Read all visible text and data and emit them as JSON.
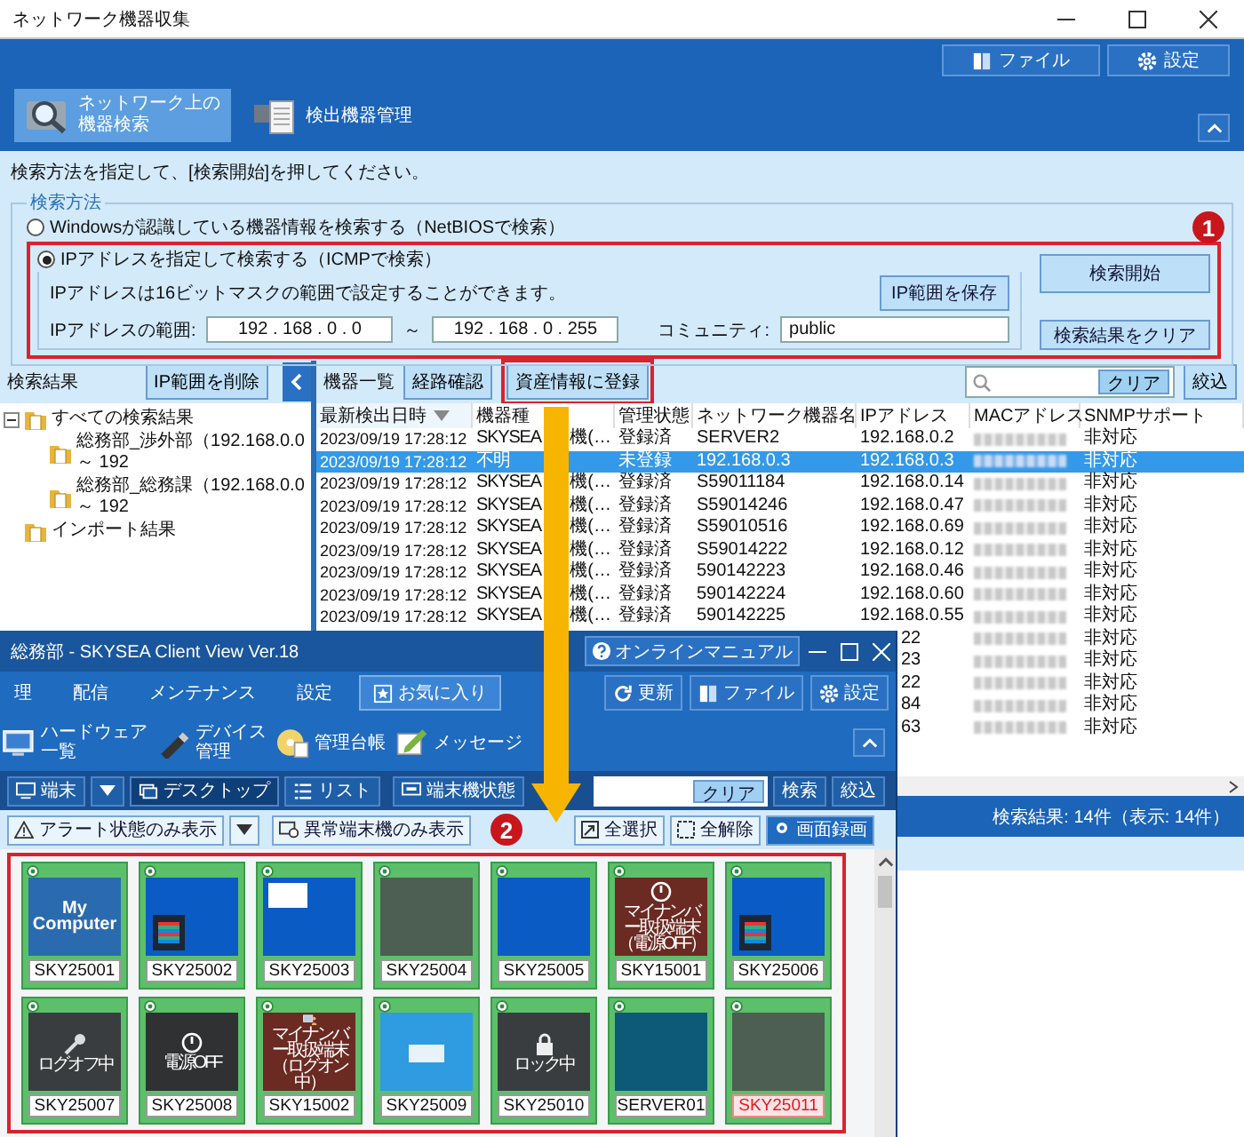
{
  "window": {
    "title": "ネットワーク機器収集",
    "menu_buttons": [
      {
        "kind": "file",
        "label": "ファイル"
      },
      {
        "kind": "gear",
        "label": "設定"
      }
    ]
  },
  "tabs": [
    {
      "kind": "search",
      "lines": [
        "ネットワーク上の",
        "機器検索"
      ],
      "selected": true
    },
    {
      "kind": "device",
      "lines": [
        "検出機器管理"
      ],
      "selected": false
    }
  ],
  "instruction": "検索方法を指定して、[検索開始]を押してください。",
  "search_method": {
    "legend": "検索方法",
    "options": [
      {
        "label": "Windowsが認識している機器情報を検索する（NetBIOSで検索）",
        "selected": false
      },
      {
        "label": "IPアドレスを指定して検索する（ICMPで検索）",
        "selected": true
      }
    ],
    "note": "IPアドレスは16ビットマスクの範囲で設定することができます。",
    "save_button": "IP範囲を保存",
    "range_label": "IPアドレスの範囲:",
    "range_from": "192 . 168 . 0 . 0",
    "range_separator": "～",
    "range_to": "192 . 168 . 0 . 255",
    "community_label": "コミュニティ:",
    "community": "public",
    "start_button": "検索開始",
    "clear_button": "検索結果をクリア"
  },
  "step_badges": [
    "1",
    "2"
  ],
  "results": {
    "title": "検索結果",
    "delete_button": "IP範囲を削除",
    "tree": [
      {
        "label": "すべての検索結果",
        "expanded": true,
        "children": [
          {
            "label": "総務部_渉外部（192.168.0.0 ～ 192"
          },
          {
            "label": "総務部_総務課（192.168.0.0 ～ 192"
          }
        ]
      },
      {
        "label": "インポート結果"
      }
    ]
  },
  "device_list": {
    "title": "機器一覧",
    "buttons": [
      {
        "label": "経路確認",
        "highlighted": false
      },
      {
        "label": "資産情報に登録",
        "highlighted": true
      }
    ],
    "clear_button": "クリア",
    "filter_button": "絞込",
    "columns": [
      {
        "label": "最新検出日時",
        "sorted": true
      },
      {
        "label": "機器種",
        "sorted": false
      },
      {
        "label": "管理状態",
        "sorted": false
      },
      {
        "label": "ネットワーク機器名",
        "sorted": false
      },
      {
        "label": "IPアドレス",
        "sorted": false
      },
      {
        "label": "MACアドレス",
        "sorted": false
      },
      {
        "label": "SNMPサポート",
        "sorted": false
      }
    ],
    "rows": [
      {
        "kind": "full",
        "date": "2023/09/19 17:28:12",
        "type": [
          "SKYSEA",
          "機(…"
        ],
        "status": "登録済",
        "name": "SERVER2",
        "ip": "192.168.0.2",
        "snmp": "非対応",
        "selected": false
      },
      {
        "kind": "full",
        "date": "2023/09/19 17:28:12",
        "type": [
          "不明"
        ],
        "status": "未登録",
        "name": "192.168.0.3",
        "ip": "192.168.0.3",
        "snmp": "非対応",
        "selected": true
      },
      {
        "kind": "full",
        "date": "2023/09/19 17:28:12",
        "type": [
          "SKYSEA",
          "機(…"
        ],
        "status": "登録済",
        "name": "S59011184",
        "ip": "192.168.0.14",
        "snmp": "非対応",
        "selected": false
      },
      {
        "kind": "full",
        "date": "2023/09/19 17:28:12",
        "type": [
          "SKYSEA",
          "機(…"
        ],
        "status": "登録済",
        "name": "S59014246",
        "ip": "192.168.0.47",
        "snmp": "非対応",
        "selected": false
      },
      {
        "kind": "full",
        "date": "2023/09/19 17:28:12",
        "type": [
          "SKYSEA",
          "機(…"
        ],
        "status": "登録済",
        "name": "S59010516",
        "ip": "192.168.0.69",
        "snmp": "非対応",
        "selected": false
      },
      {
        "kind": "full",
        "date": "2023/09/19 17:28:12",
        "type": [
          "SKYSEA",
          "機(…"
        ],
        "status": "登録済",
        "name": "S59014222",
        "ip": "192.168.0.12",
        "snmp": "非対応",
        "selected": false
      },
      {
        "kind": "full",
        "date": "2023/09/19 17:28:12",
        "type": [
          "SKYSEA",
          "機(…"
        ],
        "status": "登録済",
        "name": "590142223",
        "ip": "192.168.0.46",
        "snmp": "非対応",
        "selected": false
      },
      {
        "kind": "full",
        "date": "2023/09/19 17:28:12",
        "type": [
          "SKYSEA",
          "機(…"
        ],
        "status": "登録済",
        "name": "590142224",
        "ip": "192.168.0.60",
        "snmp": "非対応",
        "selected": false
      },
      {
        "kind": "full",
        "date": "2023/09/19 17:28:12",
        "type": [
          "SKYSEA",
          "機(…"
        ],
        "status": "登録済",
        "name": "590142225",
        "ip": "192.168.0.55",
        "snmp": "非対応",
        "selected": false
      },
      {
        "kind": "partial",
        "ip": "22",
        "snmp": "非対応",
        "selected": false
      },
      {
        "kind": "partial",
        "ip": "23",
        "snmp": "非対応",
        "selected": false
      },
      {
        "kind": "partial",
        "ip": "22",
        "snmp": "非対応",
        "selected": false
      },
      {
        "kind": "partial",
        "ip": "84",
        "snmp": "非対応",
        "selected": false
      },
      {
        "kind": "partial",
        "ip": "63",
        "snmp": "非対応",
        "selected": false
      }
    ]
  },
  "status_bar": "検索結果: 14件（表示: 14件）",
  "client": {
    "title": "総務部 - SKYSEA Client View Ver.18",
    "manual_button": "オンラインマニュアル",
    "menu": [
      {
        "kind": "menu",
        "label": "理",
        "selected": false
      },
      {
        "kind": "menu",
        "label": "配信",
        "selected": false
      },
      {
        "kind": "menu",
        "label": "メンテナンス",
        "selected": false
      },
      {
        "kind": "menu",
        "label": "設定",
        "selected": false
      },
      {
        "kind": "favorite",
        "label": "お気に入り",
        "selected": true
      }
    ],
    "actions": [
      {
        "kind": "refresh",
        "label": "更新"
      },
      {
        "kind": "file",
        "label": "ファイル"
      },
      {
        "kind": "gear",
        "label": "設定"
      }
    ],
    "tools": [
      {
        "kind": "hardware",
        "lines": [
          "ハードウェア",
          "一覧"
        ]
      },
      {
        "kind": "usb",
        "lines": [
          "デバイス",
          "管理"
        ]
      },
      {
        "kind": "ledger",
        "lines": [
          "管理台帳"
        ]
      },
      {
        "kind": "message",
        "lines": [
          "メッセージ"
        ]
      }
    ],
    "view": {
      "terminal": "端末",
      "modes": [
        {
          "kind": "desktop",
          "label": "デスクトップ",
          "selected": true
        },
        {
          "kind": "list",
          "label": "リスト",
          "selected": false
        }
      ],
      "state_button": "端末機状態",
      "clear_button": "クリア",
      "search_button": "検索",
      "filter_button": "絞込"
    },
    "filters": {
      "alert": "アラート状態のみ表示",
      "abnormal": "異常端末機のみ表示",
      "select_all": "全選択",
      "deselect_all": "全解除",
      "record": "画面録画"
    },
    "thumbnails": [
      {
        "name": "SKY25001",
        "kind": "caption",
        "caption": [
          "My",
          "Computer"
        ],
        "alert": false
      },
      {
        "name": "SKY25002",
        "kind": "desktop",
        "alert": false
      },
      {
        "name": "SKY25003",
        "kind": "window",
        "alert": false
      },
      {
        "name": "SKY25004",
        "kind": "blank",
        "alert": false
      },
      {
        "name": "SKY25005",
        "kind": "plain",
        "alert": false
      },
      {
        "name": "SKY15001",
        "kind": "power_notice",
        "caption": [
          "マイナンバー取扱端末",
          "（電源OFF）"
        ],
        "alert": false
      },
      {
        "name": "SKY25006",
        "kind": "desktop",
        "alert": false
      },
      {
        "name": "SKY25007",
        "kind": "logoff",
        "caption": [
          "ログオフ中"
        ],
        "alert": false
      },
      {
        "name": "SKY25008",
        "kind": "power",
        "caption": [
          "電源OFF"
        ],
        "alert": false
      },
      {
        "name": "SKY15002",
        "kind": "notice_user",
        "caption": [
          "マイナンバー取扱端末",
          "（ログオン中）"
        ],
        "alert": false
      },
      {
        "name": "SKY25009",
        "kind": "light",
        "alert": false
      },
      {
        "name": "SKY25010",
        "kind": "lock",
        "caption": [
          "ロック中"
        ],
        "alert": false
      },
      {
        "name": "SERVER01",
        "kind": "teal",
        "alert": false
      },
      {
        "name": "SKY25011",
        "kind": "blank",
        "alert": true
      }
    ]
  }
}
